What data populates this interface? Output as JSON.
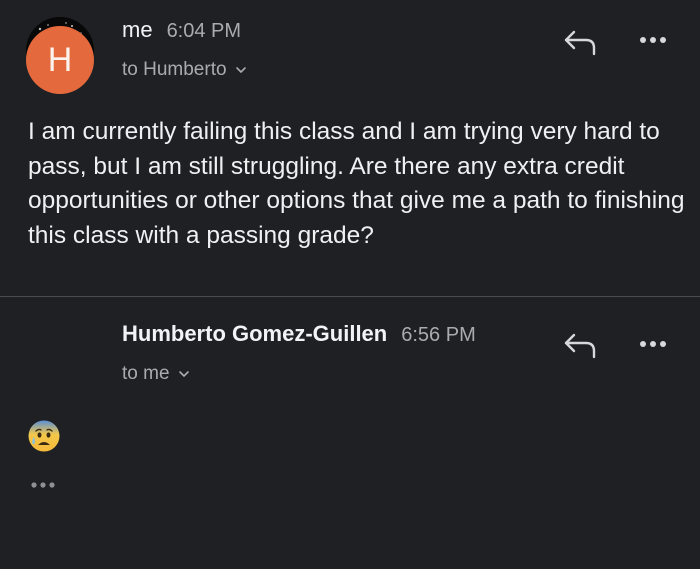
{
  "messages": [
    {
      "sender": "me",
      "time": "6:04 PM",
      "recipient": "to Humberto",
      "body": "I am currently failing this class and I am trying very hard to pass, but I am still struggling. Are there any extra credit opportunities or other options that give me a path to finishing this class with a passing grade?",
      "avatar_icon": "profile-photo"
    },
    {
      "sender": "Humberto Gomez-Guillen",
      "avatar_letter": "H",
      "avatar_color": "#e46a3e",
      "time": "6:56 PM",
      "recipient": "to me",
      "body_emoji": "anxious-face-with-sweat-emoji"
    }
  ],
  "colors": {
    "background": "#1f2023",
    "primary_text": "#e8eaed",
    "secondary_text": "#a9abaf",
    "divider": "#4a4c50"
  },
  "icons": {
    "reply": "reply-icon",
    "more": "more-options-icon",
    "chevron": "chevron-down-icon",
    "trimmed": "show-trimmed-content-icon"
  }
}
